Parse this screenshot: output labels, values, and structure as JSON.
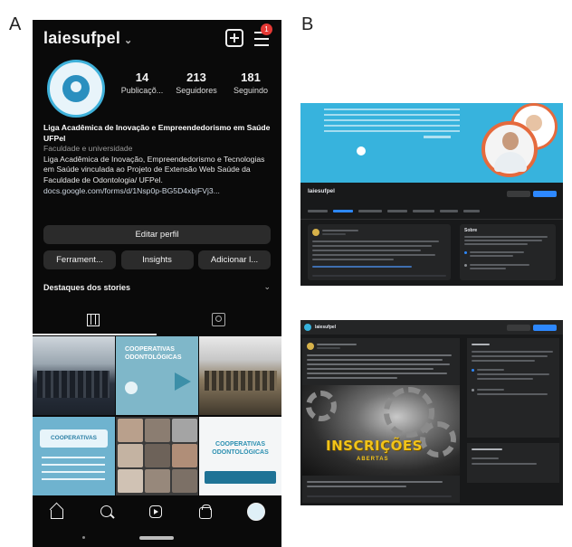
{
  "panels": {
    "a": "A",
    "b": "B"
  },
  "instagram": {
    "username": "laiesufpel",
    "caret": "⌄",
    "notification_count": "1",
    "stats": [
      {
        "value": "14",
        "label": "Publicaçõ..."
      },
      {
        "value": "213",
        "label": "Seguidores"
      },
      {
        "value": "181",
        "label": "Seguindo"
      }
    ],
    "bio": {
      "name": "Liga Acadêmica de Inovação e Empreendedorismo em Saúde UFPel",
      "category": "Faculdade e universidade",
      "text": "Liga Acadêmica de Inovação, Empreendedorismo e Tecnologias em Saúde vinculada ao Projeto de Extensão Web Saúde da Faculdade de Odontologia/ UFPel.",
      "link": "docs.google.com/forms/d/1Nsp0p-BG5D4xbjFVj3..."
    },
    "edit_profile": "Editar perfil",
    "buttons": [
      "Ferrament...",
      "Insights",
      "Adicionar l..."
    ],
    "highlights_title": "Destaques dos stories",
    "highlights_chevron": "⌄",
    "posts": {
      "post2_title": "COOPERATIVAS ODONTOLÓGICAS",
      "post4_title": "COOPERATIVAS",
      "post6_title": "COOPERATIVAS ODONTOLÓGICAS"
    }
  },
  "facebook": {
    "page1": {
      "name": "laiesufpel",
      "about_title": "Sobre"
    },
    "page2": {
      "name": "laiesufpel",
      "image_text": "INSCRIÇÕES",
      "image_sub": "ABERTAS"
    }
  }
}
